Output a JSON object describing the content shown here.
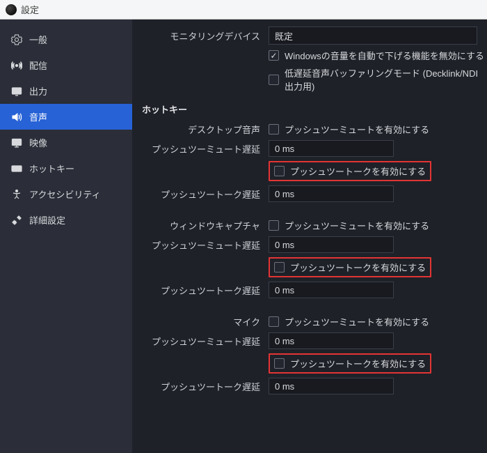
{
  "titlebar": {
    "title": "設定"
  },
  "sidebar": {
    "items": [
      {
        "label": "一般"
      },
      {
        "label": "配信"
      },
      {
        "label": "出力"
      },
      {
        "label": "音声"
      },
      {
        "label": "映像"
      },
      {
        "label": "ホットキー"
      },
      {
        "label": "アクセシビリティ"
      },
      {
        "label": "詳細設定"
      }
    ]
  },
  "monitoring": {
    "label": "モニタリングデバイス",
    "value": "既定",
    "ducking_checked": true,
    "ducking_label": "Windowsの音量を自動で下げる機能を無効にする",
    "lowlat_checked": false,
    "lowlat_label": "低遅延音声バッファリングモード (Decklink/NDI 出力用)"
  },
  "hotkeys": {
    "title": "ホットキー",
    "push_mute_label": "プッシュツーミュートを有効にする",
    "push_mute_delay_label": "プッシュツーミュート遅延",
    "push_talk_label": "プッシュツートークを有効にする",
    "push_talk_delay_label": "プッシュツートーク遅延",
    "delay_value": "0 ms",
    "devices": [
      {
        "name": "デスクトップ音声"
      },
      {
        "name": "ウィンドウキャプチャ"
      },
      {
        "name": "マイク"
      }
    ]
  }
}
